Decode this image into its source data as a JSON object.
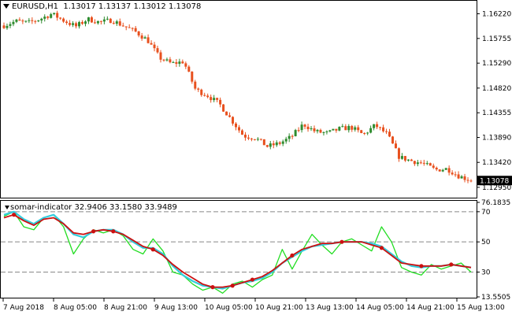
{
  "header": {
    "symbol": "EURUSD,H1",
    "ohlc": "1.13017 1.13137 1.13012 1.13078"
  },
  "price_axis": {
    "labels": [
      "1.16220",
      "1.15755",
      "1.15290",
      "1.14820",
      "1.14355",
      "1.13890",
      "1.13420",
      "1.12950"
    ],
    "current_price": "1.13078"
  },
  "indicator": {
    "name": "somar-indicator",
    "values": "32.9406 33.1580 33.9489",
    "axis_labels": [
      "76.1835",
      "70",
      "50",
      "30",
      "13.5505"
    ]
  },
  "time_axis": {
    "labels": [
      "7 Aug 2018",
      "8 Aug 05:00",
      "8 Aug 21:00",
      "9 Aug 13:00",
      "10 Aug 05:00",
      "10 Aug 21:00",
      "13 Aug 13:00",
      "14 Aug 05:00",
      "14 Aug 21:00",
      "15 Aug 13:00"
    ]
  },
  "colors": {
    "bull": "#2e8b2e",
    "bear": "#e8501e",
    "fast_line": "#22dd22",
    "slow_line": "#cc1111",
    "aux_line": "#33ccdd",
    "grid_dash": "#888888"
  },
  "chart_data": [
    {
      "type": "candlestick",
      "title": "EURUSD,H1",
      "ylim": [
        1.1277,
        1.1645
      ],
      "close_path": [
        1.16,
        1.1608,
        1.1605,
        1.1612,
        1.1622,
        1.1609,
        1.1598,
        1.1612,
        1.1606,
        1.161,
        1.1599,
        1.1588,
        1.1572,
        1.1539,
        1.1528,
        1.1532,
        1.1479,
        1.1468,
        1.1452,
        1.1422,
        1.1392,
        1.1388,
        1.1372,
        1.1378,
        1.139,
        1.1414,
        1.14,
        1.1397,
        1.1405,
        1.1408,
        1.1394,
        1.1412,
        1.1395,
        1.1352,
        1.1345,
        1.134,
        1.1328,
        1.133,
        1.1316,
        1.1308
      ]
    },
    {
      "type": "line",
      "title": "somar-indicator",
      "ylim": [
        13.5505,
        76.1835
      ],
      "levels": [
        70,
        50,
        30
      ],
      "series": [
        {
          "values": [
            67,
            70,
            60,
            58,
            66,
            68,
            60,
            42,
            52,
            58,
            56,
            58,
            54,
            45,
            42,
            52,
            44,
            30,
            28,
            22,
            18,
            20,
            16,
            22,
            24,
            20,
            25,
            28,
            45,
            32,
            44,
            55,
            48,
            42,
            50,
            52,
            48,
            44,
            60,
            50,
            33,
            30,
            28,
            35,
            32,
            34,
            36,
            30
          ]
        },
        {
          "values": [
            68,
            70,
            65,
            62,
            66,
            68,
            62,
            55,
            53,
            57,
            58,
            58,
            55,
            50,
            46,
            46,
            42,
            34,
            28,
            24,
            21,
            20,
            19,
            21,
            23,
            24,
            26,
            30,
            36,
            40,
            44,
            47,
            48,
            49,
            50,
            50,
            50,
            49,
            47,
            42,
            37,
            34,
            33,
            34,
            34,
            35,
            34,
            33
          ]
        },
        {
          "values": [
            66,
            68,
            64,
            61,
            65,
            66,
            62,
            56,
            55,
            57,
            58,
            57,
            55,
            51,
            47,
            45,
            41,
            35,
            30,
            26,
            22,
            20,
            20,
            21,
            23,
            25,
            27,
            31,
            36,
            41,
            45,
            47,
            49,
            49,
            50,
            50,
            50,
            48,
            46,
            41,
            36,
            35,
            34,
            34,
            34,
            35,
            34,
            33
          ]
        }
      ]
    }
  ]
}
